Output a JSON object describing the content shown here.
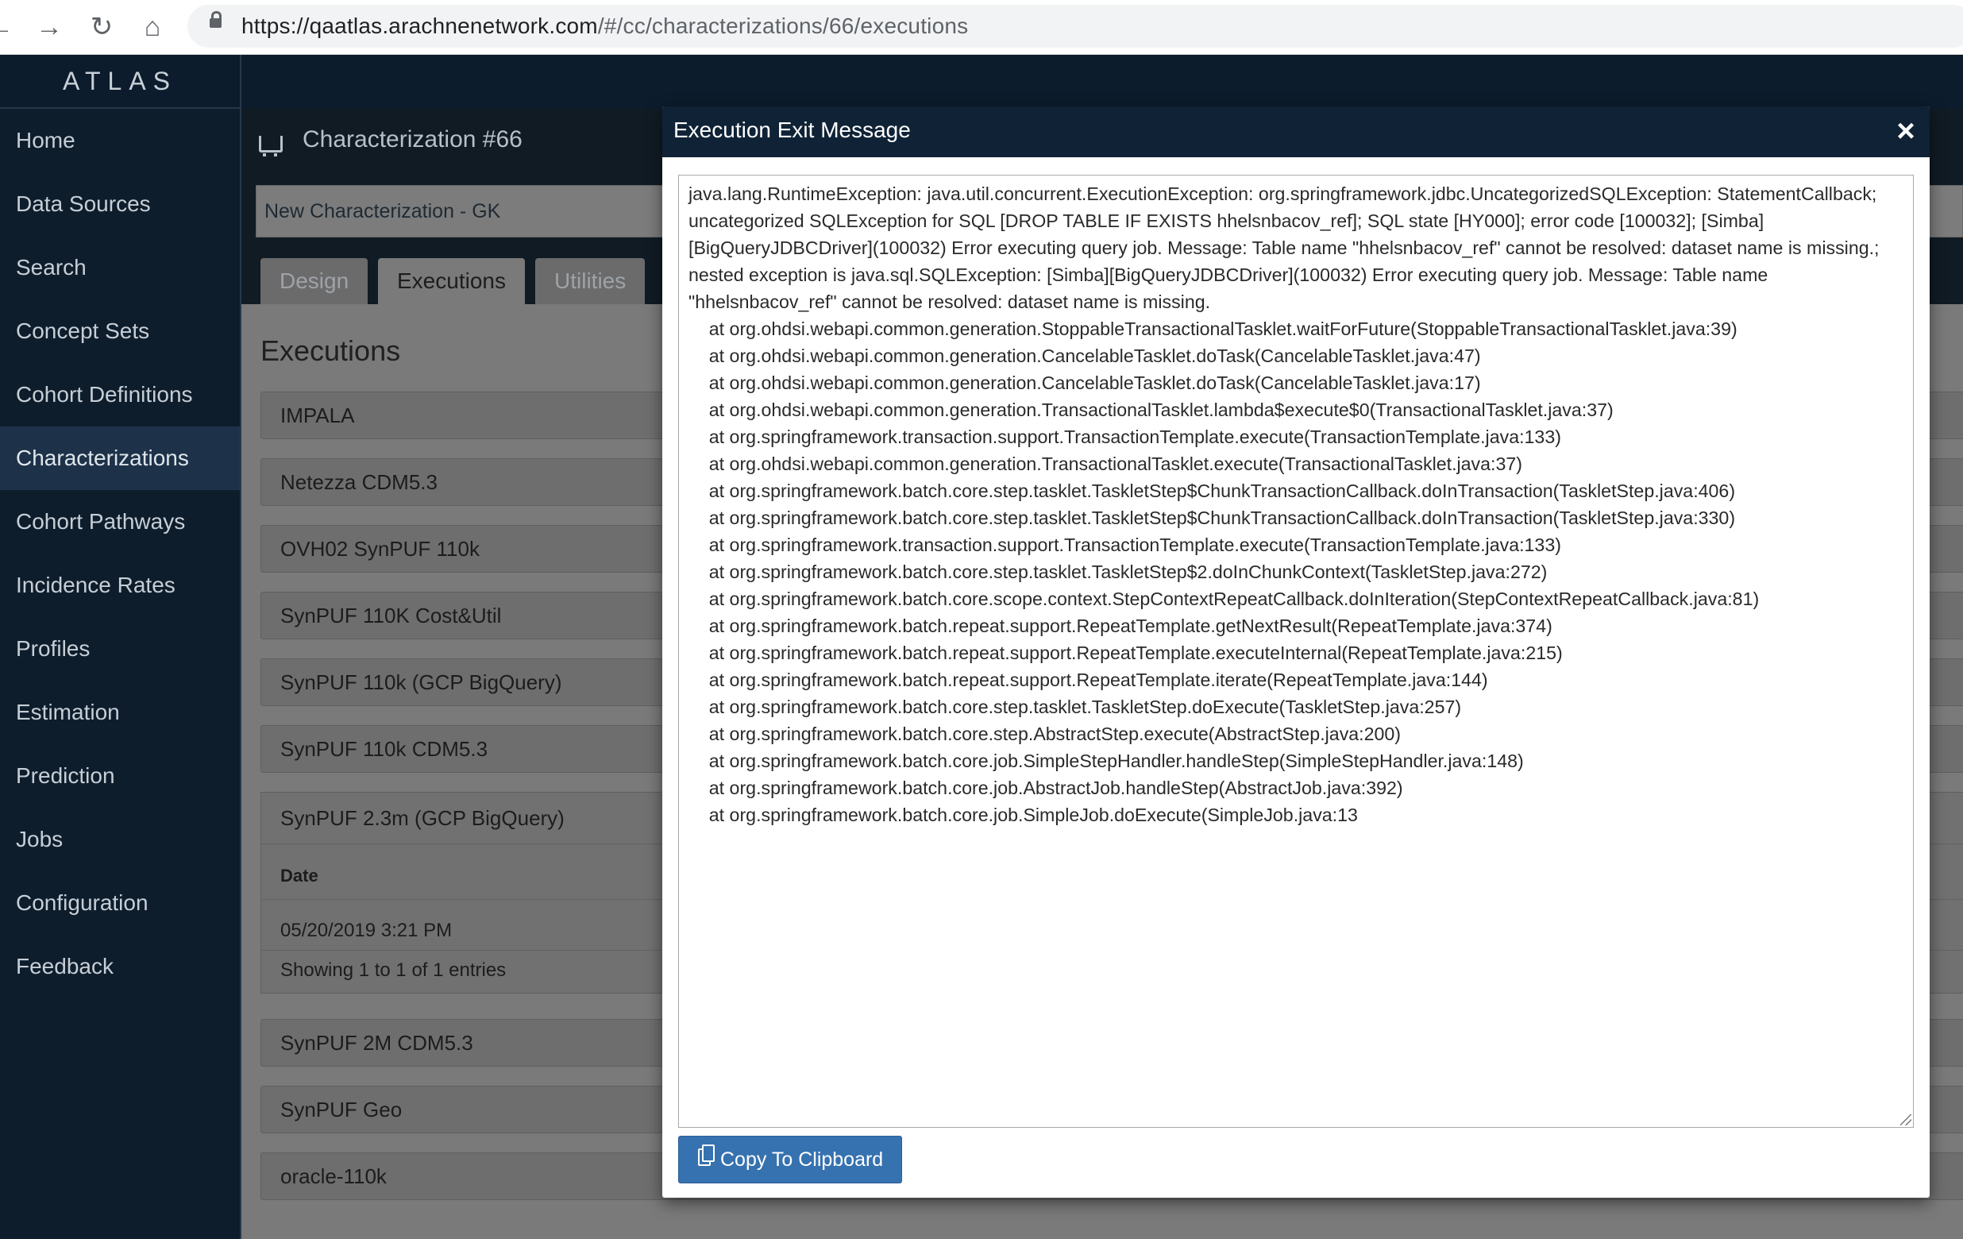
{
  "browser": {
    "url_host": "https://qaatlas.arachnenetwork.com",
    "url_path": "/#/cc/characterizations/66/executions"
  },
  "app": {
    "brand": "ATLAS"
  },
  "sidebar": {
    "items": [
      {
        "label": "Home"
      },
      {
        "label": "Data Sources"
      },
      {
        "label": "Search"
      },
      {
        "label": "Concept Sets"
      },
      {
        "label": "Cohort Definitions"
      },
      {
        "label": "Characterizations",
        "active": true
      },
      {
        "label": "Cohort Pathways"
      },
      {
        "label": "Incidence Rates"
      },
      {
        "label": "Profiles"
      },
      {
        "label": "Estimation"
      },
      {
        "label": "Prediction"
      },
      {
        "label": "Jobs"
      },
      {
        "label": "Configuration"
      },
      {
        "label": "Feedback"
      }
    ]
  },
  "characterization": {
    "title": "Characterization #66",
    "name_value": "New Characterization - GK",
    "tabs": [
      {
        "label": "Design"
      },
      {
        "label": "Executions",
        "active": true
      },
      {
        "label": "Utilities"
      }
    ],
    "executions_heading": "Executions",
    "sources": [
      {
        "label": "IMPALA"
      },
      {
        "label": "Netezza CDM5.3"
      },
      {
        "label": "OVH02 SynPUF 110k"
      },
      {
        "label": "SynPUF 110K Cost&Util"
      },
      {
        "label": "SynPUF 110k (GCP BigQuery)"
      },
      {
        "label": "SynPUF 110k CDM5.3"
      },
      {
        "label": "SynPUF 2M CDM5.3"
      },
      {
        "label": "SynPUF Geo"
      },
      {
        "label": "oracle-110k"
      }
    ],
    "expanded_source": {
      "label": "SynPUF 2.3m (GCP BigQuery)",
      "column_header": "Date",
      "row_date": "05/20/2019 3:21 PM",
      "showing": "Showing 1 to 1 of 1 entries"
    }
  },
  "modal": {
    "title": "Execution Exit Message",
    "close_symbol": "×",
    "message": "java.lang.RuntimeException: java.util.concurrent.ExecutionException: org.springframework.jdbc.UncategorizedSQLException: StatementCallback; uncategorized SQLException for SQL [DROP TABLE IF EXISTS hhelsnbacov_ref]; SQL state [HY000]; error code [100032]; [Simba][BigQueryJDBCDriver](100032) Error executing query job. Message: Table name \"hhelsnbacov_ref\" cannot be resolved: dataset name is missing.; nested exception is java.sql.SQLException: [Simba][BigQueryJDBCDriver](100032) Error executing query job. Message: Table name \"hhelsnbacov_ref\" cannot be resolved: dataset name is missing.\n\tat org.ohdsi.webapi.common.generation.StoppableTransactionalTasklet.waitForFuture(StoppableTransactionalTasklet.java:39)\n\tat org.ohdsi.webapi.common.generation.CancelableTasklet.doTask(CancelableTasklet.java:47)\n\tat org.ohdsi.webapi.common.generation.CancelableTasklet.doTask(CancelableTasklet.java:17)\n\tat org.ohdsi.webapi.common.generation.TransactionalTasklet.lambda$execute$0(TransactionalTasklet.java:37)\n\tat org.springframework.transaction.support.TransactionTemplate.execute(TransactionTemplate.java:133)\n\tat org.ohdsi.webapi.common.generation.TransactionalTasklet.execute(TransactionalTasklet.java:37)\n\tat org.springframework.batch.core.step.tasklet.TaskletStep$ChunkTransactionCallback.doInTransaction(TaskletStep.java:406)\n\tat org.springframework.batch.core.step.tasklet.TaskletStep$ChunkTransactionCallback.doInTransaction(TaskletStep.java:330)\n\tat org.springframework.transaction.support.TransactionTemplate.execute(TransactionTemplate.java:133)\n\tat org.springframework.batch.core.step.tasklet.TaskletStep$2.doInChunkContext(TaskletStep.java:272)\n\tat org.springframework.batch.core.scope.context.StepContextRepeatCallback.doInIteration(StepContextRepeatCallback.java:81)\n\tat org.springframework.batch.repeat.support.RepeatTemplate.getNextResult(RepeatTemplate.java:374)\n\tat org.springframework.batch.repeat.support.RepeatTemplate.executeInternal(RepeatTemplate.java:215)\n\tat org.springframework.batch.repeat.support.RepeatTemplate.iterate(RepeatTemplate.java:144)\n\tat org.springframework.batch.core.step.tasklet.TaskletStep.doExecute(TaskletStep.java:257)\n\tat org.springframework.batch.core.step.AbstractStep.execute(AbstractStep.java:200)\n\tat org.springframework.batch.core.job.SimpleStepHandler.handleStep(SimpleStepHandler.java:148)\n\tat org.springframework.batch.core.job.AbstractJob.handleStep(AbstractJob.java:392)\n\tat org.springframework.batch.core.job.SimpleJob.doExecute(SimpleJob.java:13",
    "copy_label": "Copy To Clipboard"
  }
}
